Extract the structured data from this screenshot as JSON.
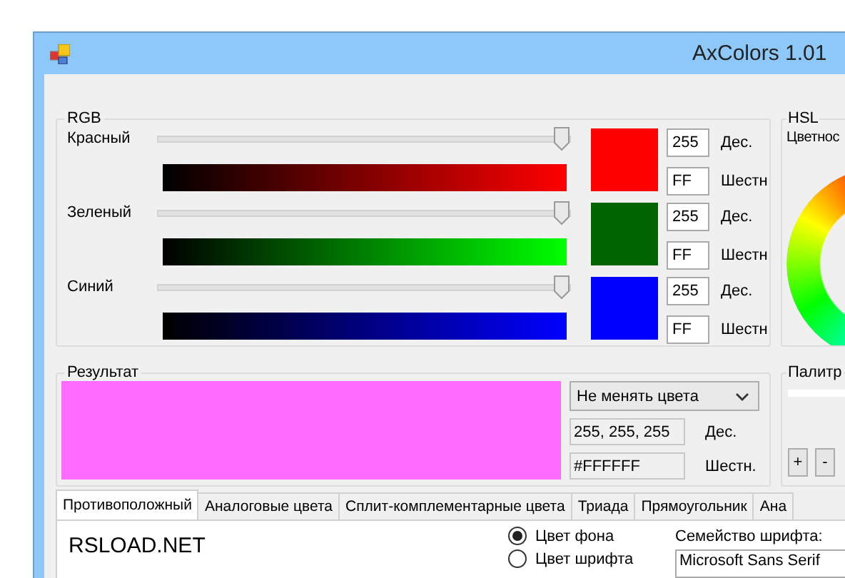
{
  "window": {
    "title": "AxColors 1.01"
  },
  "rgb": {
    "title": "RGB",
    "channels": [
      {
        "name": "Красный",
        "level": 1,
        "color": "#ff0000",
        "swatch": {
          "color": "#ff0000"
        },
        "dec": "255",
        "dec_label": "Дес.",
        "hex": "FF",
        "hex_label": "Шестн"
      },
      {
        "name": "Зеленый",
        "level": 1,
        "color": "#00ff00",
        "swatch": {
          "color": "#006400"
        },
        "dec": "255",
        "dec_label": "Дес.",
        "hex": "FF",
        "hex_label": "Шестн"
      },
      {
        "name": "Синий",
        "level": 1,
        "color": "#0000ff",
        "swatch": {
          "color": "#0000ff"
        },
        "dec": "255",
        "dec_label": "Дес.",
        "hex": "FF",
        "hex_label": "Шестн"
      }
    ]
  },
  "hsl": {
    "title": "HSL",
    "label": "Цветнос"
  },
  "result": {
    "title": "Результат",
    "color": "#ff6bff",
    "mode": "Не менять цвета",
    "dec": "255, 255, 255",
    "dec_label": "Дес.",
    "hex": "#FFFFFF",
    "hex_label": "Шестн."
  },
  "palette": {
    "title": "Палитр",
    "buttons": [
      "+",
      "-"
    ]
  },
  "tabs": [
    {
      "label": "Противоположный",
      "selected": true
    },
    {
      "label": "Аналоговые цвета",
      "selected": false
    },
    {
      "label": "Сплит-комплементарные цвета",
      "selected": false
    },
    {
      "label": "Триада",
      "selected": false
    },
    {
      "label": "Прямоугольник",
      "selected": false
    },
    {
      "label": "Ана",
      "selected": false
    }
  ],
  "preview": {
    "text": "RSLOAD.NET",
    "options": [
      {
        "label": "Цвет фона",
        "selected": true
      },
      {
        "label": "Цвет шрифта",
        "selected": false
      }
    ],
    "font_label": "Семейство шрифта:",
    "font": "Microsoft Sans Serif"
  }
}
